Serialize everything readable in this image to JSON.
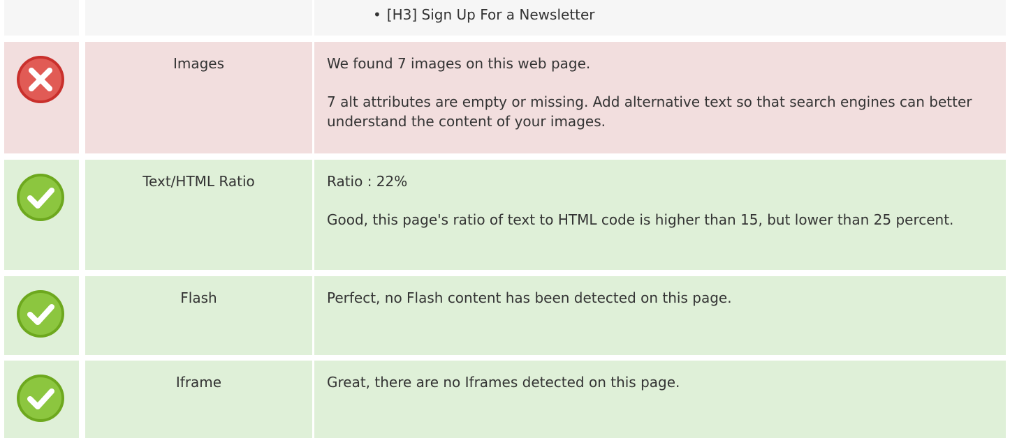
{
  "headings_row": {
    "items": [
      "[H3] Sign Up For a Newsletter"
    ]
  },
  "checks": [
    {
      "status": "error",
      "icon": "error-x-icon",
      "label": "Images",
      "lines": [
        "We found 7 images on this web page.",
        "7 alt attributes are empty or missing. Add alternative text so that search engines can better understand the content of your images."
      ]
    },
    {
      "status": "ok",
      "icon": "check-icon",
      "label": "Text/HTML Ratio",
      "lines": [
        "Ratio : 22%",
        "Good, this page's ratio of text to HTML code is higher than 15, but lower than 25 percent."
      ]
    },
    {
      "status": "ok",
      "icon": "check-icon",
      "label": "Flash",
      "lines": [
        "Perfect, no Flash content has been detected on this page."
      ]
    },
    {
      "status": "ok",
      "icon": "check-icon",
      "label": "Iframe",
      "lines": [
        "Great, there are no Iframes detected on this page."
      ]
    }
  ],
  "colors": {
    "neutral_bg": "#f6f6f6",
    "error_bg": "#f2dede",
    "ok_bg": "#dff0d8",
    "error_icon": "#d9534f",
    "ok_icon": "#8cc63f"
  }
}
